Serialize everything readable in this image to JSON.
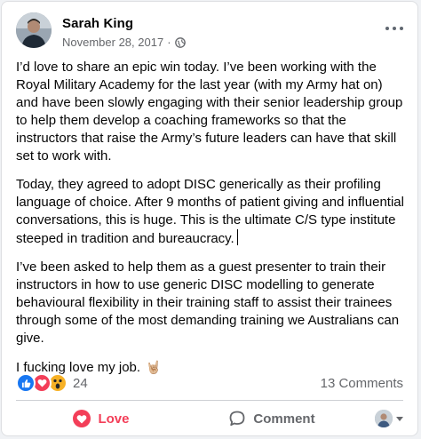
{
  "post": {
    "author": "Sarah King",
    "date": "November 28, 2017",
    "separator": "·",
    "privacy_icon": "globe-icon",
    "more_icon": "more-options-icon",
    "paragraphs": [
      "I’d love to share an epic win today. I’ve been working with the Royal Military Academy for the last year (with my Army hat on) and have been slowly engaging with their senior leadership group to help them develop a coaching frameworks so that the instructors that raise the Army’s future leaders can have that skill set to work with.",
      "Today, they agreed to adopt DISC generically as their profiling language of choice. After 9 months of patient giving and influential conversations, this is huge. This is the ultimate C/S type institute steeped in tradition and bureaucracy.",
      "I’ve been asked to help them as a guest presenter to train their instructors in how to use generic DISC modelling to generate behavioural flexibility in their training staff to assist their trainees through some of the most demanding training we Australians can give."
    ],
    "closing_text": "I fucking love my job.",
    "closing_emoji": "🤘🏼"
  },
  "stats": {
    "reaction_icons": [
      "like-icon",
      "love-icon",
      "wow-icon"
    ],
    "reaction_count": "24",
    "comments_count": "13 Comments"
  },
  "actions": {
    "love_label": "Love",
    "comment_label": "Comment"
  },
  "colors": {
    "love": "#f33e58",
    "like": "#1877f2",
    "wow": "#f7b125",
    "muted": "#65676b"
  }
}
